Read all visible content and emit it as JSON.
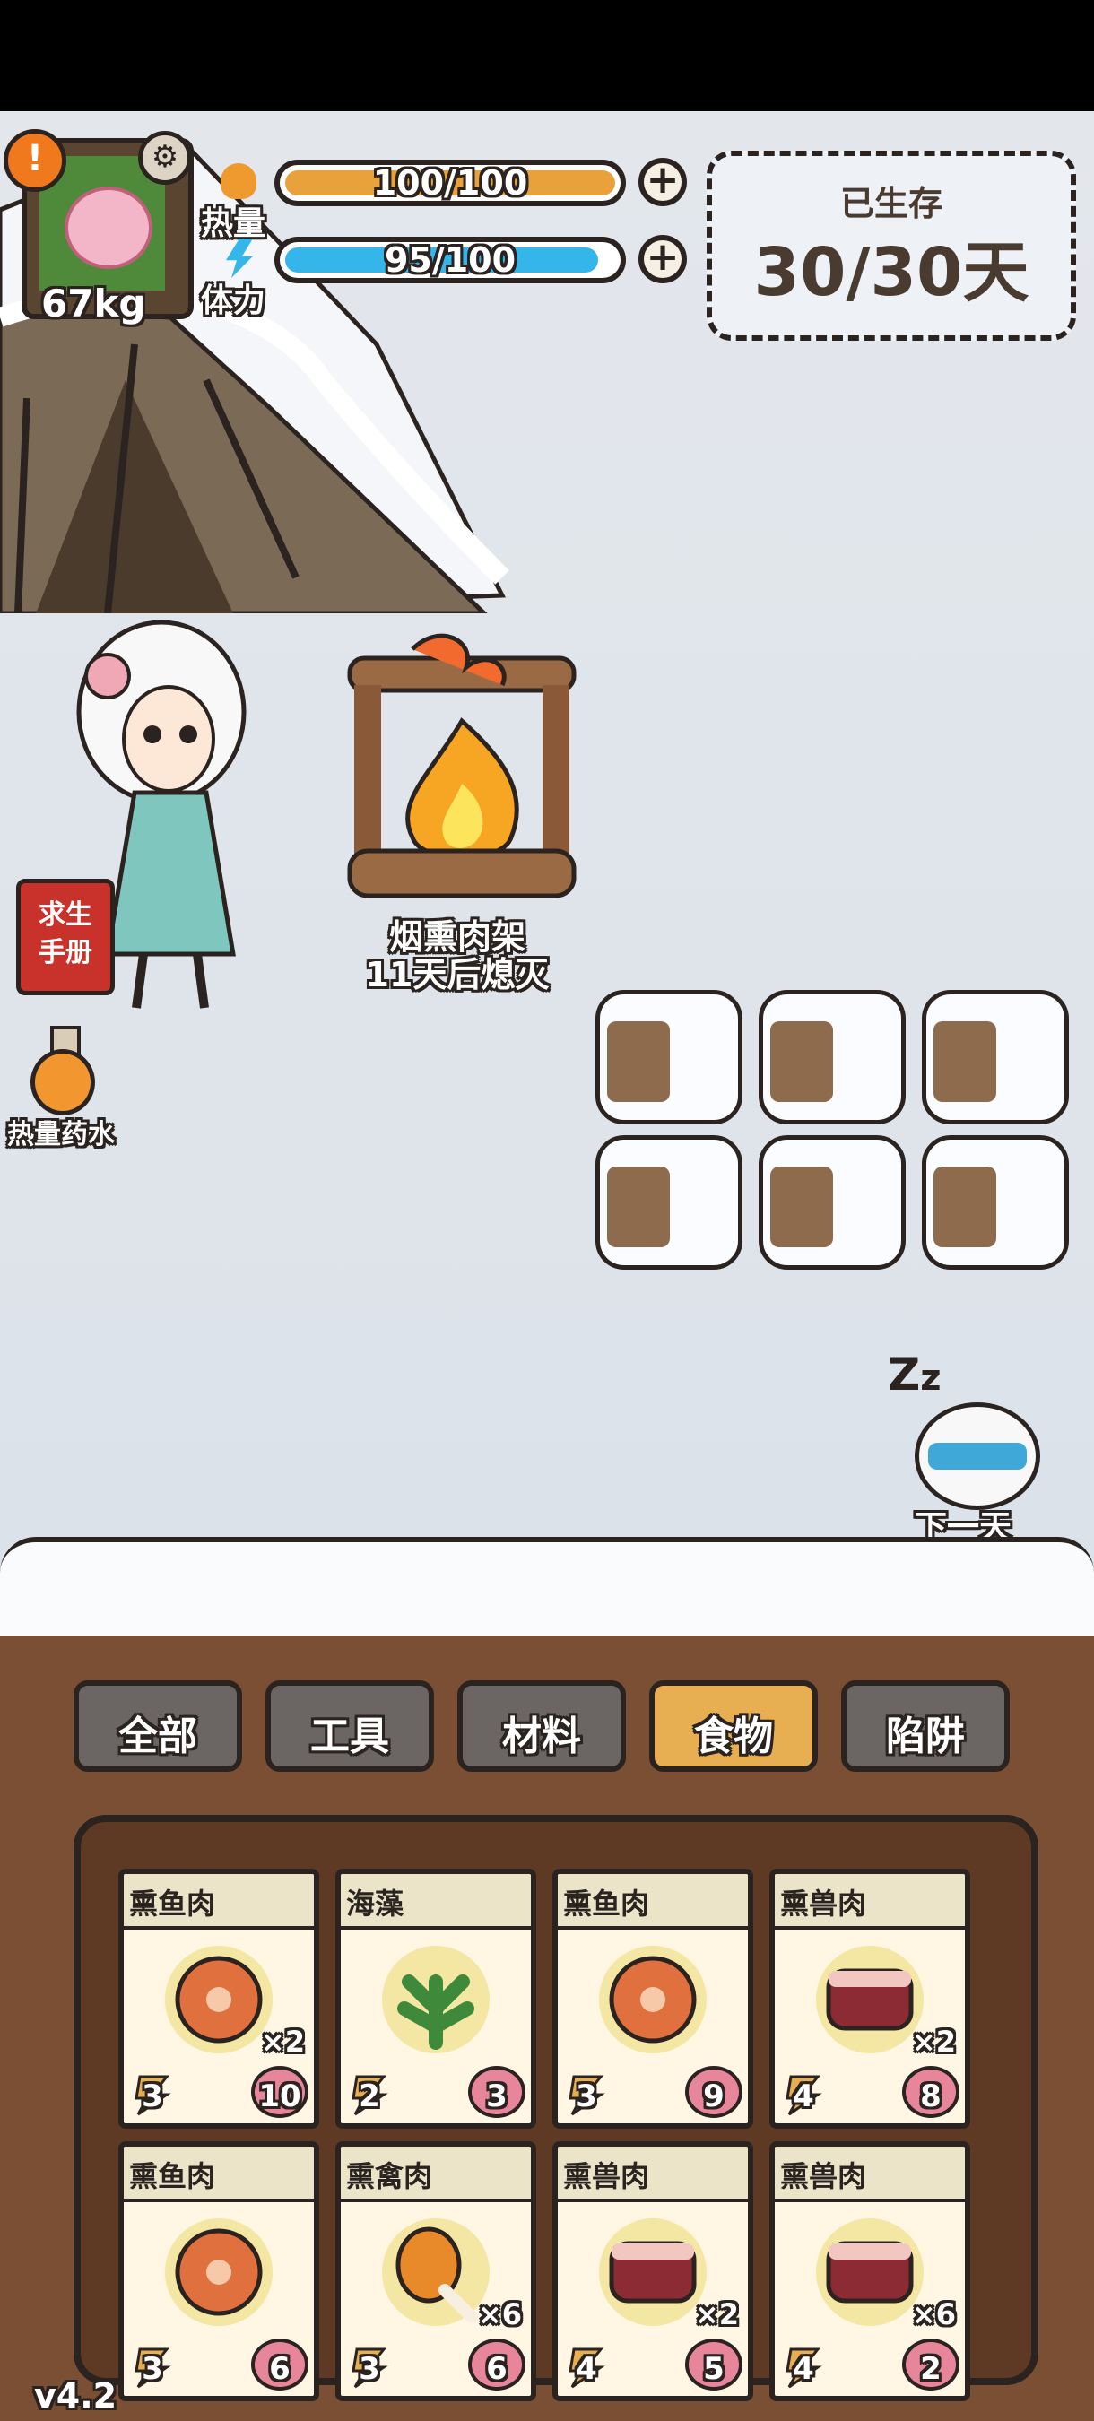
{
  "player": {
    "weight": "67kg"
  },
  "stats": {
    "heat_label": "热量",
    "heat_value": "100/100",
    "heat_level": 1.0,
    "stamina_label": "体力",
    "stamina_value": "95/100",
    "stamina_level": 0.95
  },
  "survival": {
    "label": "已生存",
    "days": "30/30天"
  },
  "campfire": {
    "name": "烟熏肉架",
    "status": "11天后熄灭"
  },
  "side": {
    "manual_line1": "求生",
    "manual_line2": "手册",
    "potion": "热量药水"
  },
  "next_day": "下一天",
  "tabs": [
    {
      "label": "全部",
      "active": false
    },
    {
      "label": "工具",
      "active": false
    },
    {
      "label": "材料",
      "active": false
    },
    {
      "label": "食物",
      "active": true
    },
    {
      "label": "陷阱",
      "active": false
    }
  ],
  "items": [
    {
      "name": "熏鱼肉",
      "icon": "fish-steak-icon",
      "qty": "×2",
      "cost": "3",
      "value": "10"
    },
    {
      "name": "海藻",
      "icon": "seaweed-icon",
      "qty": "",
      "cost": "2",
      "value": "3"
    },
    {
      "name": "熏鱼肉",
      "icon": "fish-steak-icon",
      "qty": "",
      "cost": "3",
      "value": "9"
    },
    {
      "name": "熏兽肉",
      "icon": "meat-icon",
      "qty": "×2",
      "cost": "4",
      "value": "8"
    },
    {
      "name": "熏鱼肉",
      "icon": "fish-steak-icon",
      "qty": "",
      "cost": "3",
      "value": "6"
    },
    {
      "name": "熏禽肉",
      "icon": "drumstick-icon",
      "qty": "×6",
      "cost": "3",
      "value": "6"
    },
    {
      "name": "熏兽肉",
      "icon": "meat-icon",
      "qty": "×2",
      "cost": "4",
      "value": "5"
    },
    {
      "name": "熏兽肉",
      "icon": "meat-icon",
      "qty": "×6",
      "cost": "4",
      "value": "2"
    }
  ],
  "version": "v4.2",
  "colors": {
    "heat_bar": "#e9a23b",
    "stamina_bar": "#35b6ea",
    "active_tab": "#e7ae52",
    "panel_wood": "#7a4f33"
  }
}
